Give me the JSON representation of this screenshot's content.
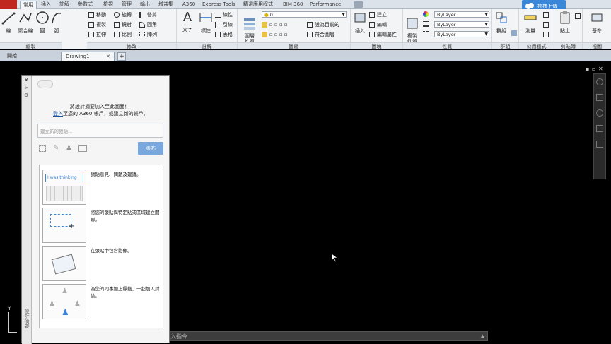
{
  "ribbon_tabs": [
    "常用",
    "插入",
    "註解",
    "參數式",
    "檢視",
    "管理",
    "輸出",
    "增益集",
    "A360",
    "Express Tools",
    "精選應用程式",
    "BIM 360",
    "Performance"
  ],
  "upload_label": "拖拽上傳",
  "draw": {
    "line": "線",
    "polyline": "聚合線",
    "circle": "圓",
    "arc": "弧"
  },
  "modify": {
    "move": "移動",
    "rotate": "旋轉",
    "trim": "修剪",
    "copy": "複製",
    "mirror": "鏡射",
    "fillet": "圓角",
    "stretch": "拉伸",
    "scale": "比例",
    "array": "陣列"
  },
  "annotation": {
    "text": "文字",
    "dimension": "標註",
    "leader": "引線",
    "table": "表格",
    "linear": "線性"
  },
  "layers": {
    "layer_props": "圖層\n性質",
    "layer_value": "0",
    "set_current": "設為目前的",
    "match_layer": "符合圖層"
  },
  "block": {
    "insert": "插入",
    "create": "建立",
    "edit": "編輯",
    "edit_attr": "編輯屬性"
  },
  "properties": {
    "match_props": "複製\n性質",
    "bylayer": "ByLayer",
    "bylayer2": "ByLayer",
    "bylayer3": "ByLayer"
  },
  "groups": {
    "group": "群組"
  },
  "utilities": {
    "measure": "測量"
  },
  "clipboard": {
    "paste": "貼上"
  },
  "view": {
    "base": "基準"
  },
  "panel_labels": [
    "繪製",
    "修改",
    "註解",
    "圖層",
    "圖塊",
    "性質",
    "群組",
    "公用程式",
    "剪貼簿",
    "視圖"
  ],
  "doc_tabs": {
    "start": "開始",
    "drawing": "Drawing1"
  },
  "notes": {
    "intro_line1": "將設計摘要加入至此圖面！",
    "signin": "登入",
    "intro_line2": "至您的 A360 帳戶，或建立新的帳戶。",
    "placeholder": "建立新的張貼...",
    "post": "張貼",
    "thumb1_text": "I was thinking",
    "feature1": "張貼意見、問題及建議。",
    "feature2": "將您的張貼與特定點或區域建立關聯。",
    "feature3": "在張貼中包含影像。",
    "feature4": "為您的同事加上標籤，一起加入討論。",
    "side_label": "設計摘要"
  },
  "command_placeholder": "入指令",
  "ucs_y": "Y"
}
